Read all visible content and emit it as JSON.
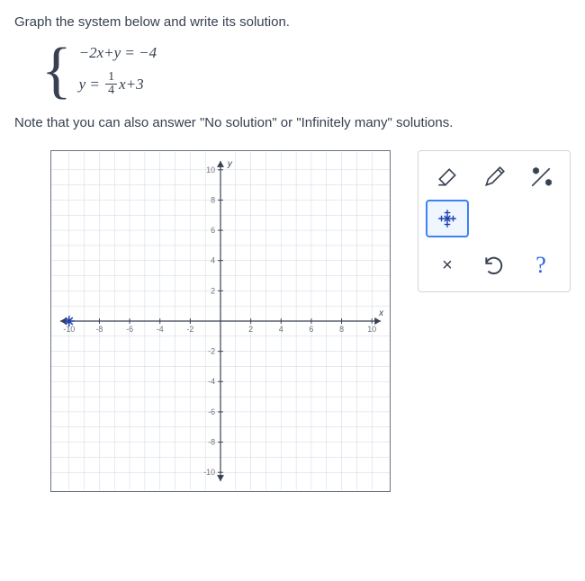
{
  "instruction": "Graph the system below and write its solution.",
  "equations": {
    "eq1_prefix": "−2",
    "eq1_x": "x",
    "eq1_plus": "+",
    "eq1_y": "y",
    "eq1_eq": "= −4",
    "eq2_y": "y",
    "eq2_eq": "=",
    "eq2_frac_num": "1",
    "eq2_frac_den": "4",
    "eq2_x": "x",
    "eq2_plus3": "+3"
  },
  "note": "Note that you can also answer \"No solution\" or \"Infinitely many\" solutions.",
  "axis": {
    "x_label": "x",
    "y_label": "y",
    "ticks_pos": [
      "2",
      "4",
      "6",
      "8",
      "10"
    ],
    "ticks_neg": [
      "-2",
      "-4",
      "-6",
      "-8",
      "-10"
    ]
  },
  "tools": {
    "eraser": "eraser-icon",
    "pencil": "pencil-icon",
    "line": "line-tool-icon",
    "point": "point-tool-icon",
    "close": "×",
    "undo": "undo-icon",
    "help": "?"
  }
}
